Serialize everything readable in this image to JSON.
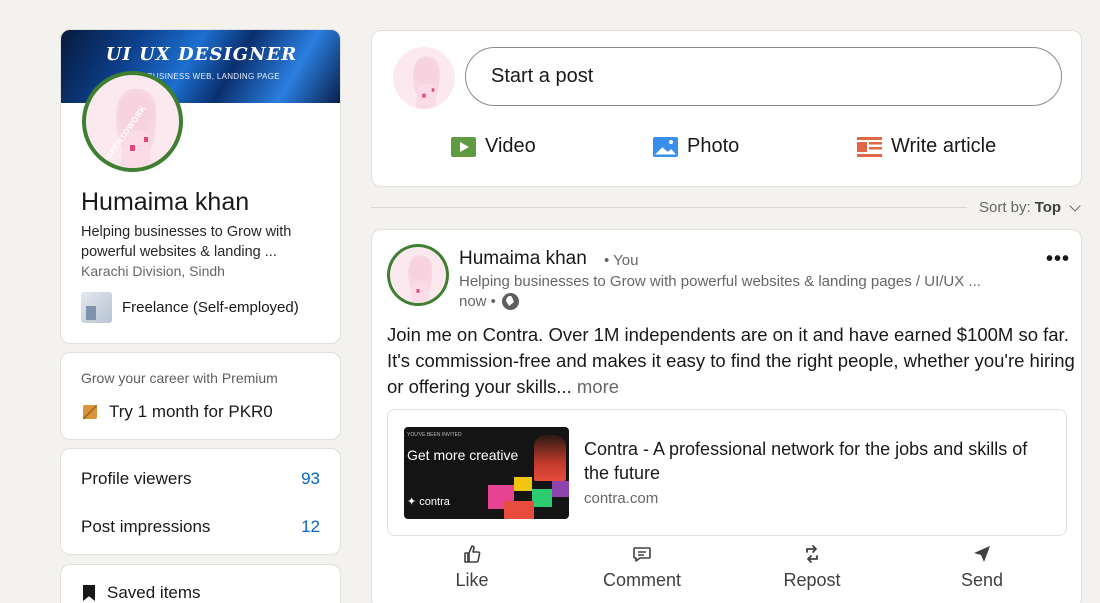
{
  "profile": {
    "banner_title": "UI UX DESIGNER",
    "banner_subtitle": "WEB, BUSINESS WEB, LANDING PAGE",
    "open_to_work": "#OPENTOWORK",
    "name": "Humaima khan",
    "headline": "Helping businesses to Grow with powerful websites & landing ...",
    "location": "Karachi Division, Sindh",
    "company": "Freelance (Self-employed)"
  },
  "premium": {
    "text": "Grow your career with Premium",
    "cta": "Try 1 month for PKR0"
  },
  "stats": [
    {
      "label": "Profile viewers",
      "value": "93"
    },
    {
      "label": "Post impressions",
      "value": "12"
    }
  ],
  "saved": {
    "label": "Saved items"
  },
  "compose": {
    "placeholder": "Start a post",
    "actions": [
      {
        "label": "Video",
        "icon": "video-icon",
        "color": "#5f9b41"
      },
      {
        "label": "Photo",
        "icon": "photo-icon",
        "color": "#378fe9"
      },
      {
        "label": "Write article",
        "icon": "article-icon",
        "color": "#e06847"
      }
    ]
  },
  "sort": {
    "prefix": "Sort by:",
    "value": "Top"
  },
  "post": {
    "author": "Humaima khan",
    "relation": "• You",
    "headline": "Helping businesses to Grow with powerful websites & landing pages / UI/UX ...",
    "time": "now •",
    "text": "Join me on Contra. Over 1M independents are on it and have earned $100M  so far. It's commission-free and makes it easy to find the right people, whether you're hiring or offering your skills...",
    "see_more": "more",
    "link": {
      "thumb_small": "YOU'VE BEEN INVITED",
      "thumb_title": "Get more creative",
      "thumb_logo": "✦ contra",
      "title": "Contra - A professional network for the jobs and skills of the future",
      "domain": "contra.com"
    },
    "actions": [
      {
        "label": "Like",
        "icon": "like-icon"
      },
      {
        "label": "Comment",
        "icon": "comment-icon"
      },
      {
        "label": "Repost",
        "icon": "repost-icon"
      },
      {
        "label": "Send",
        "icon": "send-icon"
      }
    ]
  }
}
